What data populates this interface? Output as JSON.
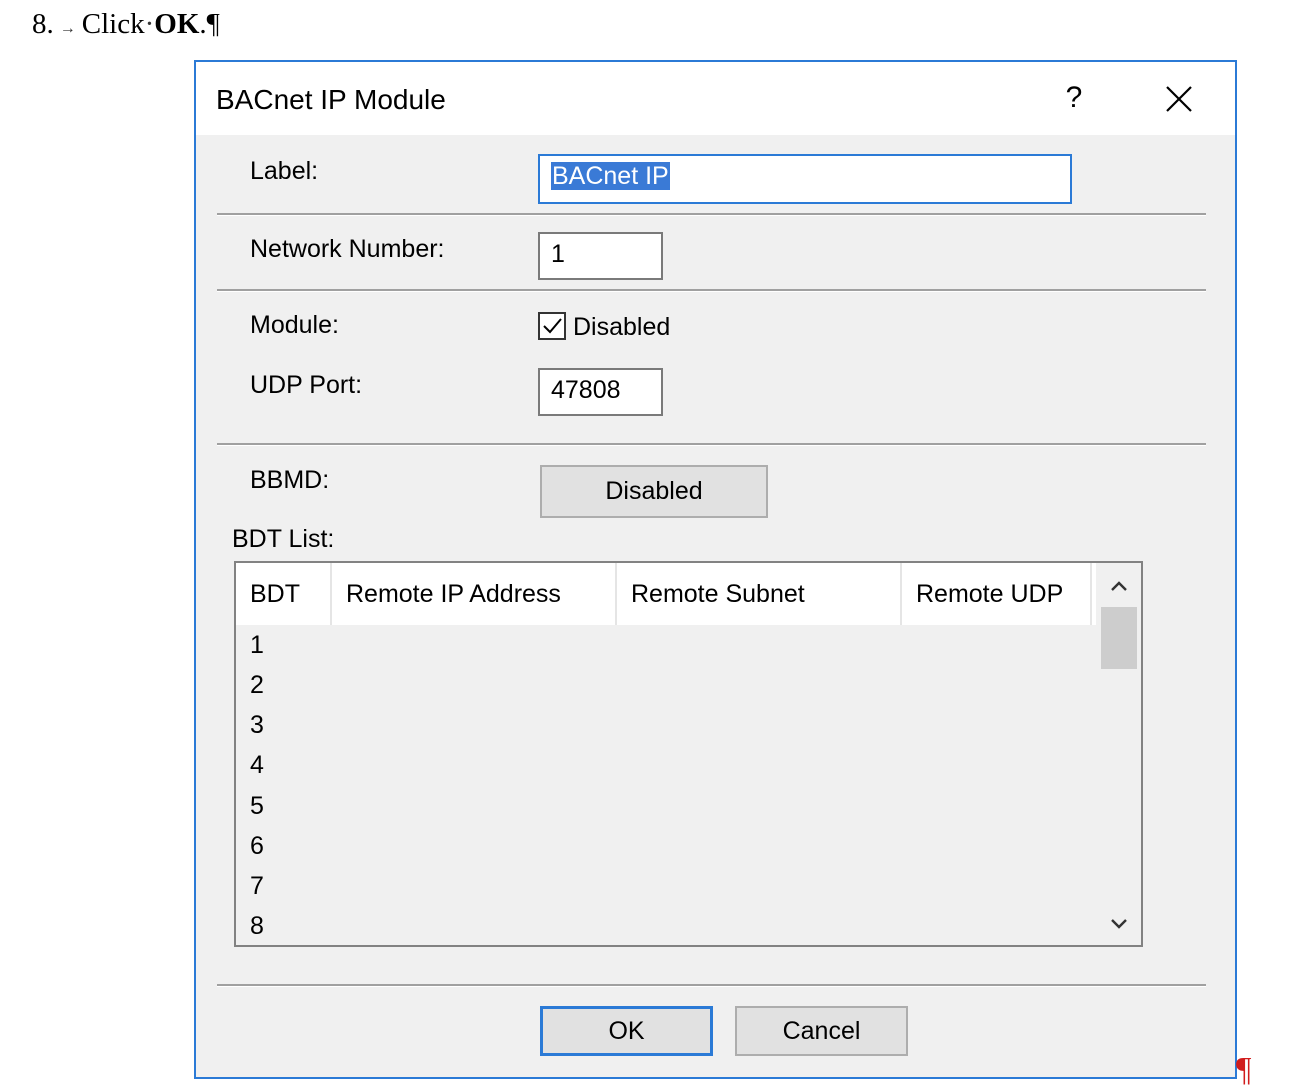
{
  "doc": {
    "step_number": "8.",
    "arrow": "→",
    "click_word": "Click",
    "dot": "·",
    "ok_word": "OK",
    "end": ".¶",
    "trailing_pilcrow": "¶"
  },
  "dialog": {
    "title": "BACnet IP Module",
    "help_label": "?",
    "label_caption": "Label:",
    "label_value": "BACnet IP",
    "network_number_caption": "Network Number:",
    "network_number_value": "1",
    "module_caption": "Module:",
    "module_checkbox_label": "Disabled",
    "module_checked": true,
    "udp_port_caption": "UDP Port:",
    "udp_port_value": "47808",
    "bbmd_caption": "BBMD:",
    "bbmd_button_label": "Disabled",
    "bdt_list_caption": "BDT List:",
    "bdt_columns": [
      "BDT",
      "Remote IP Address",
      "Remote Subnet",
      "Remote UDP"
    ],
    "bdt_rows": [
      "1",
      "2",
      "3",
      "4",
      "5",
      "6",
      "7",
      "8"
    ],
    "ok_label": "OK",
    "cancel_label": "Cancel"
  },
  "colors": {
    "accent": "#2b7ad6",
    "dialog_bg": "#f0f0f0",
    "pilcrow": "#d11c1c"
  }
}
